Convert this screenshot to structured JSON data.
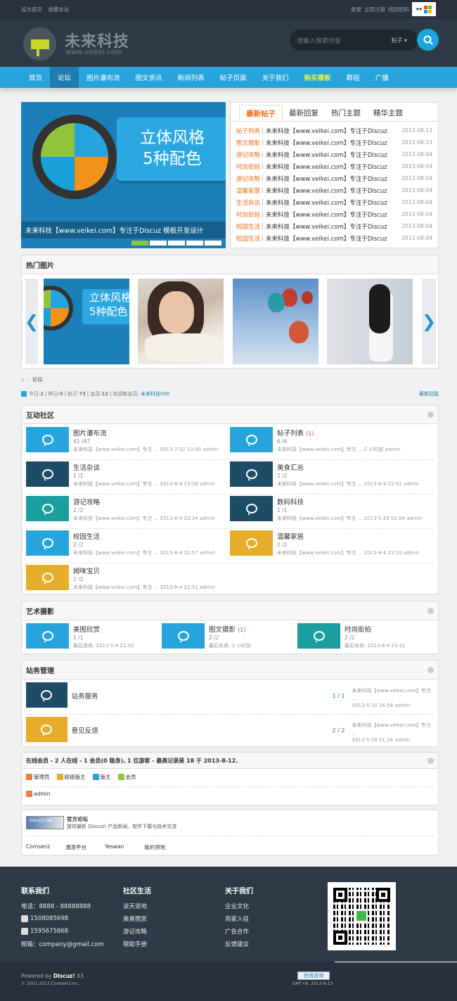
{
  "topbar": {
    "set_home": "设为首页",
    "bookmark": "收藏本站",
    "login": "登录",
    "register": "立即注册",
    "find_pwd": "找回密码",
    "lang_symbol": "↔"
  },
  "header": {
    "logo_title": "未来科技",
    "logo_sub": "www.veikei.com",
    "search_placeholder": "请输入搜索内容",
    "search_type": "帖子"
  },
  "nav": [
    "首页",
    "论坛",
    "图片瀑布流",
    "图文资讯",
    "新闻列表",
    "帖子页面",
    "关于我们",
    "购买模板",
    "群组",
    "广播"
  ],
  "slider": {
    "banner_line1": "立体风格",
    "banner_line2": "5种配色",
    "caption": "未来科技【www.veikei.com】专注于Discuz 模板开发设计"
  },
  "tabs": [
    "最新帖子",
    "最新回复",
    "热门主题",
    "精华主题"
  ],
  "latest": [
    {
      "cat": "帖子列表",
      "title": "未来科技【www.veikei.com】专注于Discuz",
      "date": "2013-08-13"
    },
    {
      "cat": "图文摄影",
      "title": "未来科技【www.veikei.com】专注于Discuz",
      "date": "2013-08-13"
    },
    {
      "cat": "游记攻略",
      "title": "未来科技【www.veikei.com】专注于Discuz",
      "date": "2013-08-04"
    },
    {
      "cat": "时尚街拍",
      "title": "未来科技【www.veikei.com】专注于Discuz",
      "date": "2013-08-04"
    },
    {
      "cat": "游记攻略",
      "title": "未来科技【www.veikei.com】专注于Discuz",
      "date": "2013-08-04"
    },
    {
      "cat": "温馨家居",
      "title": "未来科技【www.veikei.com】专注于Discuz",
      "date": "2013-08-04"
    },
    {
      "cat": "生活杂谈",
      "title": "未来科技【www.veikei.com】专注于Discuz",
      "date": "2013-08-04"
    },
    {
      "cat": "时尚街拍",
      "title": "未来科技【www.veikei.com】专注于Discuz",
      "date": "2013-08-04"
    },
    {
      "cat": "校园生活",
      "title": "未来科技【www.veikei.com】专注于Discuz",
      "date": "2013-08-04"
    },
    {
      "cat": "校园生活",
      "title": "未来科技【www.veikei.com】专注于Discuz",
      "date": "2013-08-04"
    }
  ],
  "hot_images": {
    "title": "热门图片",
    "thumb1_line1": "立体风格",
    "thumb1_line2": "5种配色"
  },
  "crumb": "论坛",
  "stats": {
    "today_label": "今日:",
    "today": "2",
    "yesterday_label": "昨日:",
    "yesterday": "0",
    "posts_label": "帖子:",
    "posts": "73",
    "members_label": "会员:",
    "members": "12",
    "welcome": "欢迎新会员:",
    "newest": "未来科技VIIII",
    "latest_reply": "最新回复"
  },
  "sections": {
    "s1": {
      "title": "互动社区",
      "forums": [
        {
          "name": "图片瀑布流",
          "new": "",
          "count": "41 /47",
          "last": "未来科技【www.veikei.com】专注 ... 2013-7-22 13:40 admin",
          "color": "#27a4dc"
        },
        {
          "name": "帖子列表",
          "new": "(1)",
          "count": "6 /6",
          "last": "未来科技【www.veikei.com】专注 ... 2 小时前 admin",
          "color": "#27a4dc"
        },
        {
          "name": "生活杂谈",
          "new": "",
          "count": "1 /1",
          "last": "未来科技【www.veikei.com】专注 ... 2013-8-4 23:08 admin",
          "color": "#1d4d66"
        },
        {
          "name": "美食汇总",
          "new": "",
          "count": "2 /2",
          "last": "未来科技【www.veikei.com】专注 ... 2013-8-4 22:52 admin",
          "color": "#1d4d66"
        },
        {
          "name": "游记攻略",
          "new": "",
          "count": "2 /2",
          "last": "未来科技【www.veikei.com】专注 ... 2013-8-4 23:34 admin",
          "color": "#1a9e9f"
        },
        {
          "name": "数码科技",
          "new": "",
          "count": "1 /1",
          "last": "未来科技【www.veikei.com】专注 ... 2013-5-29 01:04 admin",
          "color": "#1d4d66"
        },
        {
          "name": "校园生活",
          "new": "",
          "count": "2 /2",
          "last": "未来科技【www.veikei.com】专注 ... 2013-8-4 22:57 admin",
          "color": "#27a4dc"
        },
        {
          "name": "温馨家居",
          "new": "",
          "count": "2 /2",
          "last": "未来科技【www.veikei.com】专注 ... 2013-8-4 23:10 admin",
          "color": "#e6ae2a"
        },
        {
          "name": "姆咪宝贝",
          "new": "",
          "count": "2 /2",
          "last": "未来科技【www.veikei.com】专注 ... 2013-8-4 22:51 admin",
          "color": "#e6ae2a"
        }
      ]
    },
    "s2": {
      "title": "艺术摄影",
      "forums": [
        {
          "name": "美图欣赏",
          "new": "",
          "count": "1 /1",
          "last": "最后发表: 2013-5-8 21:55",
          "color": "#27a4dc"
        },
        {
          "name": "图文摄影",
          "new": "(1)",
          "count": "2 /2",
          "last": "最后发表: 2 小时前",
          "color": "#27a4dc"
        },
        {
          "name": "时尚街拍",
          "new": "",
          "count": "2 /2",
          "last": "最后发表: 2013-8-4 23:21",
          "color": "#1a9e9f"
        }
      ]
    },
    "s3": {
      "title": "站务管理",
      "forums": [
        {
          "name": "站务服务",
          "count": "1 / 1",
          "last1": "未来科技【www.veikei.com】专注 ...",
          "last2": "2013-5-10 16:58 admin",
          "color": "#1d4d66"
        },
        {
          "name": "意见反馈",
          "count": "2 / 2",
          "last1": "未来科技【www.veikei.com】专注 ...",
          "last2": "2013-5-28 01:34 admin",
          "color": "#e6ae2a"
        }
      ]
    }
  },
  "online": {
    "summary": "在线会员 - 2 人在线 - 1 会员(0 隐身), 1 位游客 - 最高记录是 18 于 2013-8-12.",
    "legend": [
      "管理员",
      "超级版主",
      "版主",
      "会员"
    ],
    "user": "admin"
  },
  "links": {
    "logo_text": "Discuz!.net",
    "title": "官方论坛",
    "desc": "提供最新 Discuz! 产品新闻、软件下载与技术交流",
    "items": [
      "Comsenz",
      "漫游平台",
      "Yeswan",
      "我的领地"
    ]
  },
  "footer": {
    "contact": {
      "title": "联系我们",
      "phone": "电话：8888 - 88888888",
      "qq1": "1508085698",
      "qq2": "1595675868",
      "email": "邮箱：company@gmail.com"
    },
    "life": {
      "title": "社区生活",
      "items": [
        "谈天说地",
        "美景图赏",
        "游记攻略",
        "帮助手册"
      ]
    },
    "about": {
      "title": "关于我们",
      "items": [
        "企业文化",
        "商家入驻",
        "广告合作",
        "反馈建议"
      ]
    }
  },
  "bottom": {
    "powered": "Powered by ",
    "brand": "Discuz!",
    "version": " X3",
    "copyright": "© 2001-2013 Comsenz Inc.",
    "chat": "在线咨询",
    "gmt": "GMT+8, 2013-8-13"
  },
  "colors": {
    "accent": "#27a4dc",
    "orange": "#f46f1a",
    "dark": "#2e3a46"
  }
}
